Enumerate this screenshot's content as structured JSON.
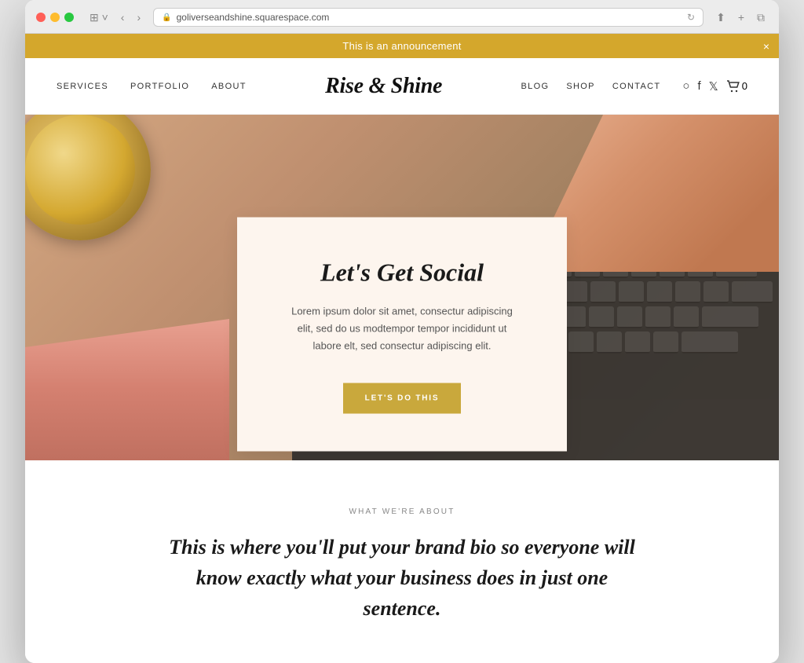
{
  "browser": {
    "url": "goliverseandshine.squarespace.com",
    "refresh_label": "↻"
  },
  "announcement": {
    "text": "This is an announcement",
    "close_label": "×"
  },
  "nav": {
    "logo": "Rise & Shine",
    "left_links": [
      {
        "label": "SERVICES",
        "id": "services"
      },
      {
        "label": "PORTFOLIO",
        "id": "portfolio"
      },
      {
        "label": "ABOUT",
        "id": "about"
      }
    ],
    "right_links": [
      {
        "label": "BLOG",
        "id": "blog"
      },
      {
        "label": "SHOP",
        "id": "shop"
      },
      {
        "label": "CONTACT",
        "id": "contact"
      }
    ],
    "cart_count": "0"
  },
  "hero": {
    "card": {
      "title": "Let's Get Social",
      "body": "Lorem ipsum dolor sit amet, consectur adipiscing elit, sed do us modtempor tempor incididunt ut labore elt, sed consectur adipiscing elit.",
      "button_label": "LET'S DO THIS"
    }
  },
  "about": {
    "label": "WHAT WE'RE ABOUT",
    "title": "This is where you'll put your brand bio so everyone will know exactly what your business does in just one sentence."
  }
}
